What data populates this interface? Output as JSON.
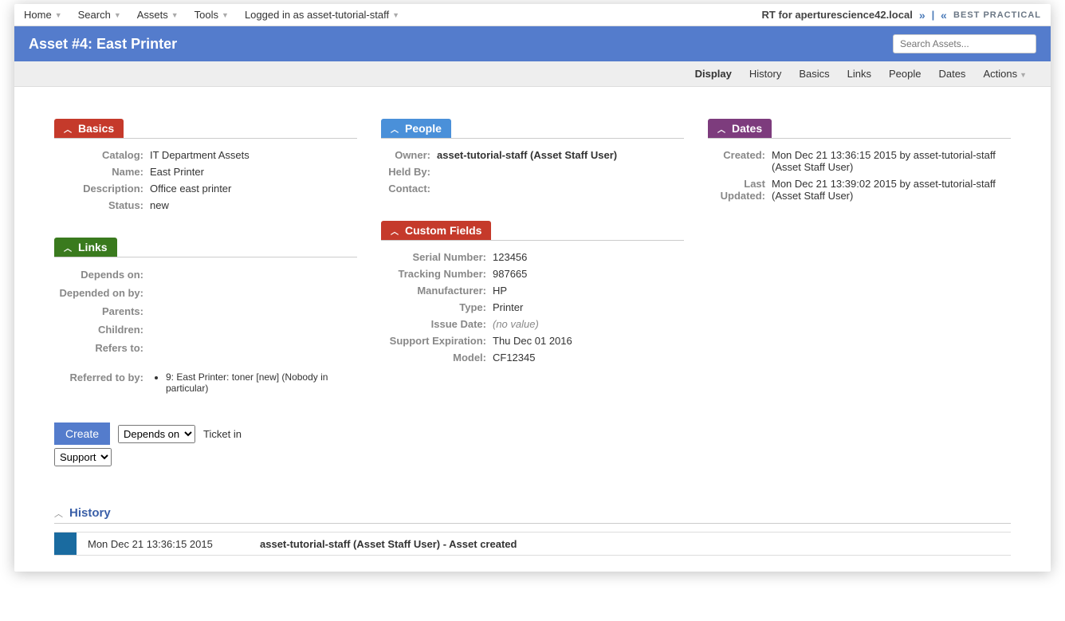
{
  "topnav": {
    "items": [
      "Home",
      "Search",
      "Assets",
      "Tools"
    ],
    "logged_in": "Logged in as asset-tutorial-staff",
    "rt_label": "RT for aperturescience42.local",
    "logo_text": "BEST PRACTICAL"
  },
  "titlebar": {
    "title": "Asset #4: East Printer",
    "search_placeholder": "Search Assets..."
  },
  "subnav": [
    "Display",
    "History",
    "Basics",
    "Links",
    "People",
    "Dates",
    "Actions"
  ],
  "subnav_active": "Display",
  "basics": {
    "title": "Basics",
    "rows": [
      {
        "label": "Catalog:",
        "value": "IT Department Assets"
      },
      {
        "label": "Name:",
        "value": "East Printer"
      },
      {
        "label": "Description:",
        "value": "Office east printer"
      },
      {
        "label": "Status:",
        "value": "new"
      }
    ]
  },
  "people": {
    "title": "People",
    "rows": [
      {
        "label": "Owner:",
        "value": "asset-tutorial-staff (Asset Staff User)",
        "bold": true
      },
      {
        "label": "Held By:",
        "value": ""
      },
      {
        "label": "Contact:",
        "value": ""
      }
    ]
  },
  "dates": {
    "title": "Dates",
    "rows": [
      {
        "label": "Created:",
        "value": "Mon Dec 21 13:36:15 2015 by asset-tutorial-staff (Asset Staff User)"
      },
      {
        "label": "Last Updated:",
        "value": "Mon Dec 21 13:39:02 2015 by asset-tutorial-staff (Asset Staff User)"
      }
    ]
  },
  "links": {
    "title": "Links",
    "rows": [
      {
        "label": "Depends on:"
      },
      {
        "label": "Depended on by:"
      },
      {
        "label": "Parents:"
      },
      {
        "label": "Children:"
      },
      {
        "label": "Refers to:"
      }
    ],
    "referred_label": "Referred to by:",
    "referred_items": [
      "9: East Printer: toner [new] (Nobody in particular)"
    ],
    "create_btn": "Create",
    "select1": "Depends on",
    "ticket_in": "Ticket in",
    "select2": "Support"
  },
  "custom_fields": {
    "title": "Custom Fields",
    "rows": [
      {
        "label": "Serial Number:",
        "value": "123456"
      },
      {
        "label": "Tracking Number:",
        "value": "987665"
      },
      {
        "label": "Manufacturer:",
        "value": "HP"
      },
      {
        "label": "Type:",
        "value": "Printer"
      },
      {
        "label": "Issue Date:",
        "value": "(no value)",
        "italic": true
      },
      {
        "label": "Support Expiration:",
        "value": "Thu Dec 01 2016"
      },
      {
        "label": "Model:",
        "value": "CF12345"
      }
    ]
  },
  "history": {
    "title": "History",
    "date": "Mon Dec 21 13:36:15 2015",
    "desc": "asset-tutorial-staff (Asset Staff User) - Asset created"
  }
}
